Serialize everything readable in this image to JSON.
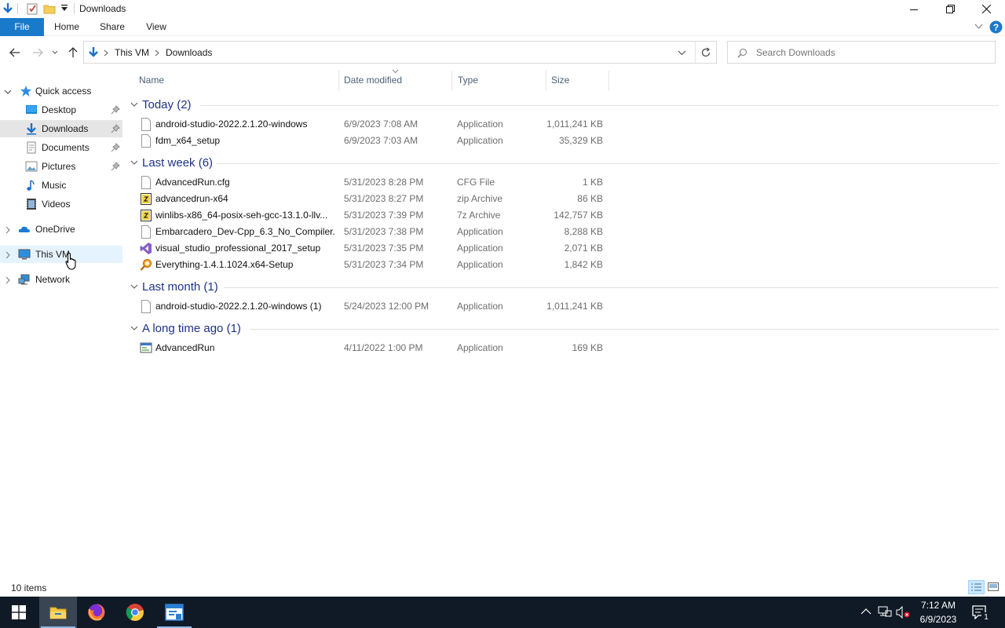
{
  "window": {
    "title": "Downloads",
    "ribbon_tabs": [
      "File",
      "Home",
      "Share",
      "View"
    ]
  },
  "address": {
    "crumbs": [
      "This VM",
      "Downloads"
    ],
    "search_placeholder": "Search Downloads"
  },
  "nav": {
    "quick_access": "Quick access",
    "pinned": [
      {
        "label": "Desktop",
        "icon": "desktop-icon"
      },
      {
        "label": "Downloads",
        "icon": "downloads-icon"
      },
      {
        "label": "Documents",
        "icon": "documents-icon"
      },
      {
        "label": "Pictures",
        "icon": "pictures-icon"
      }
    ],
    "unpinned": [
      {
        "label": "Music",
        "icon": "music-icon"
      },
      {
        "label": "Videos",
        "icon": "videos-icon"
      }
    ],
    "roots": [
      {
        "label": "OneDrive",
        "icon": "onedrive-icon"
      },
      {
        "label": "This VM",
        "icon": "this-pc-icon"
      },
      {
        "label": "Network",
        "icon": "network-icon"
      }
    ]
  },
  "columns": {
    "name": "Name",
    "date": "Date modified",
    "type": "Type",
    "size": "Size"
  },
  "groups": [
    {
      "title": "Today (2)",
      "files": [
        {
          "name": "android-studio-2022.2.1.20-windows",
          "date": "6/9/2023 7:08 AM",
          "type": "Application",
          "size": "1,011,241 KB",
          "icon": "blank-file-icon"
        },
        {
          "name": "fdm_x64_setup",
          "date": "6/9/2023 7:03 AM",
          "type": "Application",
          "size": "35,329 KB",
          "icon": "blank-file-icon"
        }
      ]
    },
    {
      "title": "Last week (6)",
      "files": [
        {
          "name": "AdvancedRun.cfg",
          "date": "5/31/2023 8:28 PM",
          "type": "CFG File",
          "size": "1 KB",
          "icon": "blank-file-icon"
        },
        {
          "name": "advancedrun-x64",
          "date": "5/31/2023 8:27 PM",
          "type": "zip Archive",
          "size": "86 KB",
          "icon": "archive-icon"
        },
        {
          "name": "winlibs-x86_64-posix-seh-gcc-13.1.0-llv...",
          "date": "5/31/2023 7:39 PM",
          "type": "7z Archive",
          "size": "142,757 KB",
          "icon": "archive-icon"
        },
        {
          "name": "Embarcadero_Dev-Cpp_6.3_No_Compiler...",
          "date": "5/31/2023 7:38 PM",
          "type": "Application",
          "size": "8,288 KB",
          "icon": "blank-file-icon"
        },
        {
          "name": "visual_studio_professional_2017_setup",
          "date": "5/31/2023 7:35 PM",
          "type": "Application",
          "size": "2,071 KB",
          "icon": "visual-studio-icon"
        },
        {
          "name": "Everything-1.4.1.1024.x64-Setup",
          "date": "5/31/2023 7:34 PM",
          "type": "Application",
          "size": "1,842 KB",
          "icon": "everything-search-icon"
        }
      ]
    },
    {
      "title": "Last month (1)",
      "files": [
        {
          "name": "android-studio-2022.2.1.20-windows (1)",
          "date": "5/24/2023 12:00 PM",
          "type": "Application",
          "size": "1,011,241 KB",
          "icon": "blank-file-icon"
        }
      ]
    },
    {
      "title": "A long time ago (1)",
      "files": [
        {
          "name": "AdvancedRun",
          "date": "4/11/2022 1:00 PM",
          "type": "Application",
          "size": "169 KB",
          "icon": "app-window-icon"
        }
      ]
    }
  ],
  "status": {
    "item_count": "10 items"
  },
  "taskbar": {
    "apps": [
      "file-explorer-icon",
      "firefox-icon",
      "chrome-icon",
      "remote-app-icon"
    ],
    "time": "7:12 AM",
    "date": "6/9/2023",
    "notifications_count": "1"
  },
  "colors": {
    "accent": "#1979ca",
    "group_header": "#1e3287",
    "taskbar": "#101a26"
  }
}
